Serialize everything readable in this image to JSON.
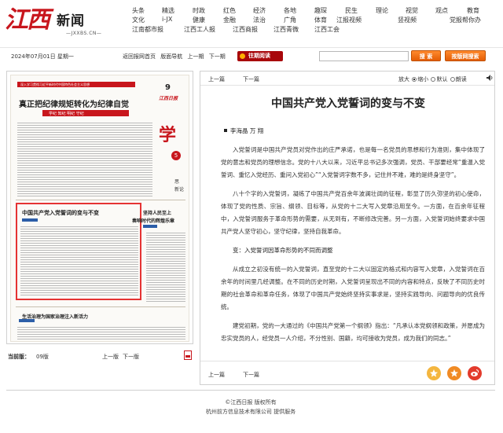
{
  "header": {
    "logo_mark": "江西",
    "logo_name": "新闻",
    "logo_url": "—JXXBS.CN—",
    "nav_rows": [
      [
        "头条",
        "精选",
        "时政",
        "红色",
        "经济",
        "各地",
        "趣琛",
        "民生",
        "理论",
        "视觉",
        "观点",
        "教育"
      ],
      [
        "文化",
        "i-JX",
        "健康",
        "金融",
        "法治",
        "广角",
        "体育",
        "江报视频",
        "",
        "竖视频",
        "",
        "党报帮你办"
      ],
      [
        "江南都市报",
        "江西工人报",
        "江西商报",
        "江西青微",
        "江西工会"
      ]
    ]
  },
  "toolbar": {
    "date": "2024年07月01日 星期一",
    "links": [
      "返回报网首页",
      "版面导航",
      "上一期",
      "下一期"
    ],
    "history_label": "往期阅读",
    "search_placeholder": "",
    "search_button": "搜 索",
    "advanced_search_button": "按版网搜索"
  },
  "paper": {
    "banner": "深入学习贯彻习近平新时代中国特色社会主义思想",
    "page_no": "9",
    "brand": "江西日报",
    "headline": "真正把纪律规矩转化为纪律自觉",
    "sub_band": "学纪  知纪  明纪  守纪",
    "red_glyph": "学",
    "red_circle": "5",
    "side_label_1": "思",
    "side_label_2": "新论",
    "highlight_title": "中国共产党入党誓词的变与不变",
    "right_head_1": "坚持人民至上",
    "right_head_2": "奏响时代的辉煌乐章",
    "bottom_head": "生活治理为国家治理注入新活力"
  },
  "left_footer": {
    "label": "当前版：",
    "value": "09版",
    "prev": "上一版",
    "next": "下一版"
  },
  "article": {
    "nav_prev": "上一篇",
    "nav_next": "下一篇",
    "font_label": "放大",
    "font_options": [
      "缩小",
      "默认"
    ],
    "read_label": "朗读",
    "title": "中国共产党入党誓词的变与不变",
    "author": "李海晶 万 翔",
    "paragraphs": [
      "入党誓词是中国共产党员对党作出的庄严承诺，也是每一名党员的思想和行为准则，集中体现了党的意志和党员的理想信念。党的十八大以来，习近平总书记多次强调，党员、干部要经常“重温入党誓词、重忆入党经历、重问入党初心”“入党誓词字数不多，记住并不难，难的是终身坚守”。",
      "八十个字的入党誓词，凝练了中国共产党百余年波澜壮阔的征程，彰显了历久弥坚的初心使命，体现了党的性质、宗旨、纲领、目标等，从党的十二大写入党章沿用至今。一方面，在百余年征程中，入党誓词服务于革命形势的需要，从无到有，不断修改完善。另一方面，入党誓词始终要求中国共产党人坚守初心，坚守纪律，坚持自我革命。",
      "变：入党誓词因革命形势的不同而调整",
      "从成立之初没有统一的入党誓词，直至党的十二大以固定的格式和内容写入党章，入党誓词在百余年的时间里几经调整。在不同的历史时期，入党誓词呈现出不同的内容和特点，反映了不同历史时期的社会革命和革命任务，体现了中国共产党始终坚持实事求是，坚持实践导向、问题导向的优良传统。",
      "建党初期，党的一大通过的《中国共产党第一个纲领》指出：“凡承认本党纲领和政策，并愿成为忠实党员的人，经党员一人介绍，不分性别、国籍，均可接收为党员，成为我们的同志。”"
    ],
    "foot_prev": "上一篇",
    "foot_next": "下一篇"
  },
  "footer": {
    "line1": "©江西日报 版权所有",
    "line2": "杭州前方信息技术有限公司   提供服务"
  },
  "colors": {
    "brand_red": "#c8161d",
    "orange_button": "#e45d04",
    "history_button": "#a8070b"
  }
}
